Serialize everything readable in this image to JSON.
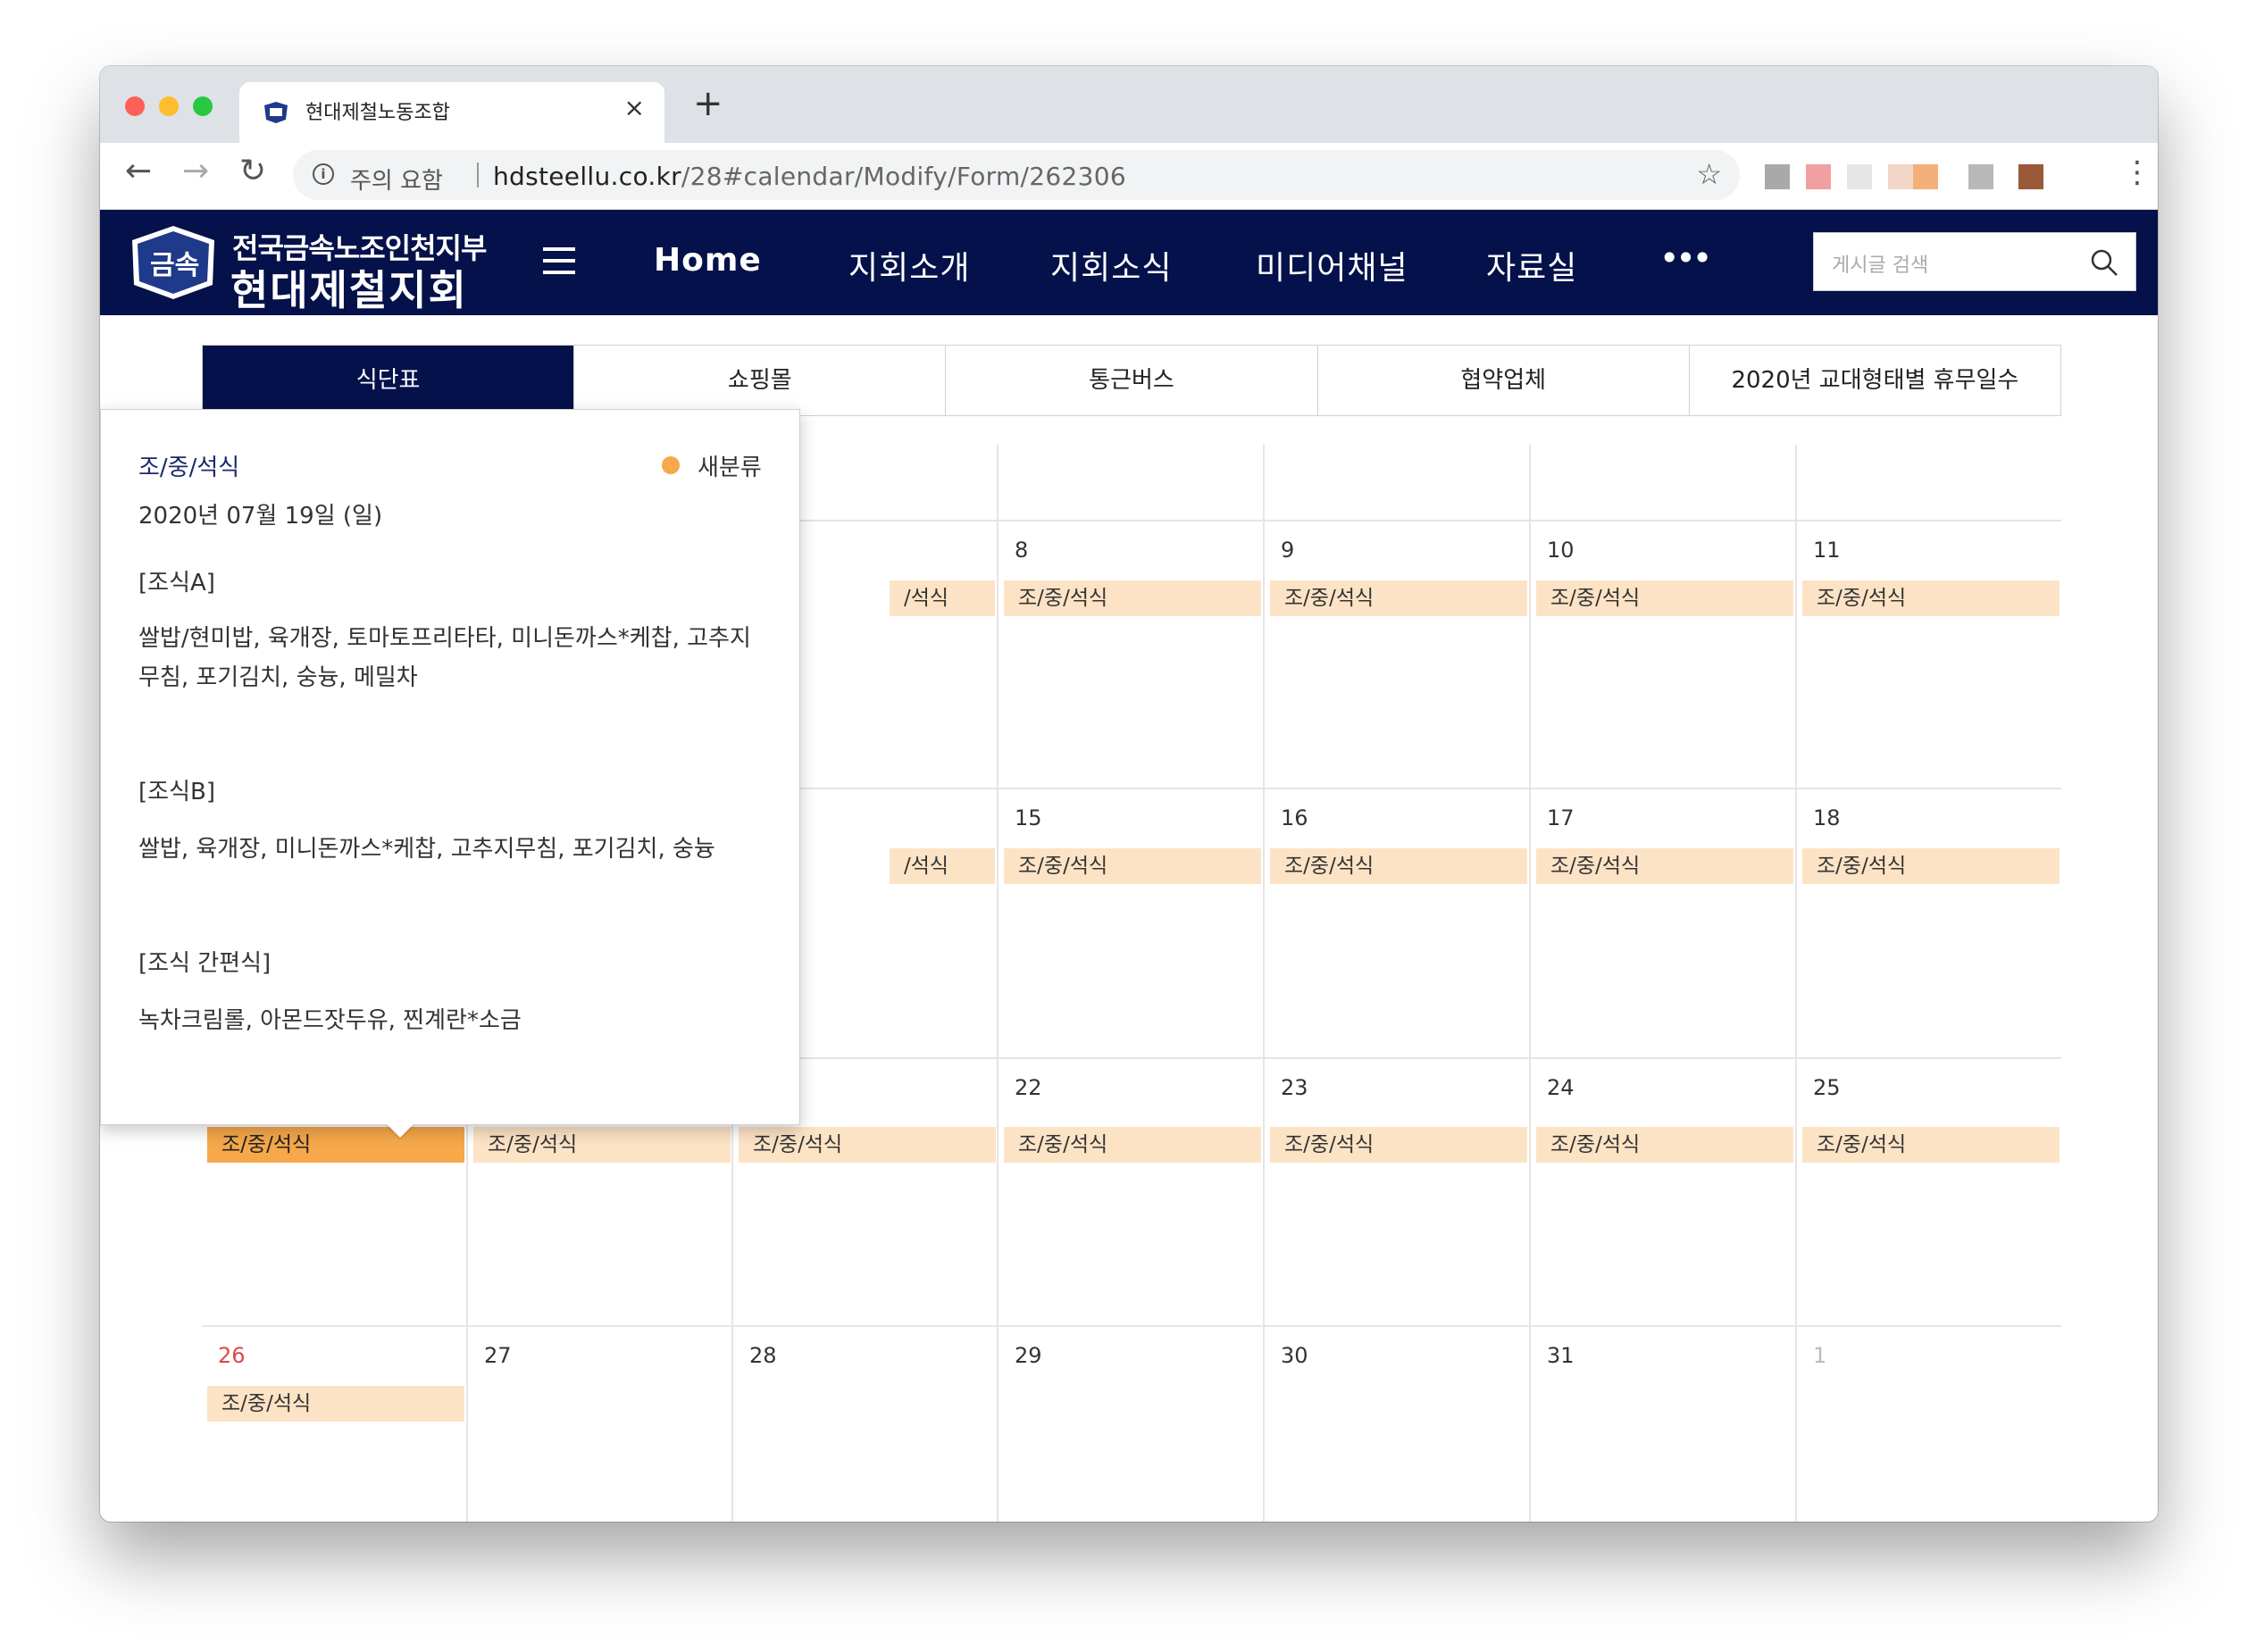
{
  "browser": {
    "tab_title": "현대제철노동조합",
    "tab_close": "×",
    "new_tab": "+",
    "security_label": "주의 요함",
    "url_host": "hdsteellu.co.kr",
    "url_path": "/28#calendar/Modify/Form/262306",
    "back_glyph": "←",
    "forward_glyph": "→",
    "reload_glyph": "↻",
    "star_glyph": "☆",
    "menu_glyph": "⋮"
  },
  "site": {
    "logo_emblem_text": "금속",
    "logo_top": "전국금속노조인천지부",
    "logo_main": "현대제철지회",
    "nav": [
      "Home",
      "지회소개",
      "지회소식",
      "미디어채널",
      "자료실"
    ],
    "more": "•••",
    "search_placeholder": "게시글 검색"
  },
  "subtabs": [
    "식단표",
    "쇼핑몰",
    "통근버스",
    "협약업체",
    "2020년 교대형태별 휴무일수"
  ],
  "calendar": {
    "event_label": "조/중/석식",
    "event_partial": "/석식",
    "week2_days": [
      "8",
      "9",
      "10",
      "11"
    ],
    "week3_days": [
      "15",
      "16",
      "17",
      "18"
    ],
    "week4_days": [
      "22",
      "23",
      "24",
      "25"
    ],
    "week5_days": [
      "26",
      "27",
      "28",
      "29",
      "30",
      "31",
      "1"
    ]
  },
  "popover": {
    "title": "조/중/석식",
    "category": "새분류",
    "category_color": "#f6a84a",
    "date": "2020년 07월 19일 (일)",
    "lines": [
      "[조식A]",
      "쌀밥/현미밥, 육개장, 토마토프리타타, 미니돈까스*케찹, 고추지",
      "무침, 포기김치, 숭늉, 메밀차",
      "[조식B]",
      "쌀밥, 육개장, 미니돈까스*케찹, 고추지무침, 포기김치, 숭늉",
      "[조식 간편식]",
      "녹차크림롤, 아몬드잣두유, 찐계란*소금"
    ]
  },
  "colors": {
    "header_bg": "#04114a",
    "event_bg": "#fde3c6",
    "event_selected": "#f6a84a",
    "sunday": "#e04848"
  }
}
